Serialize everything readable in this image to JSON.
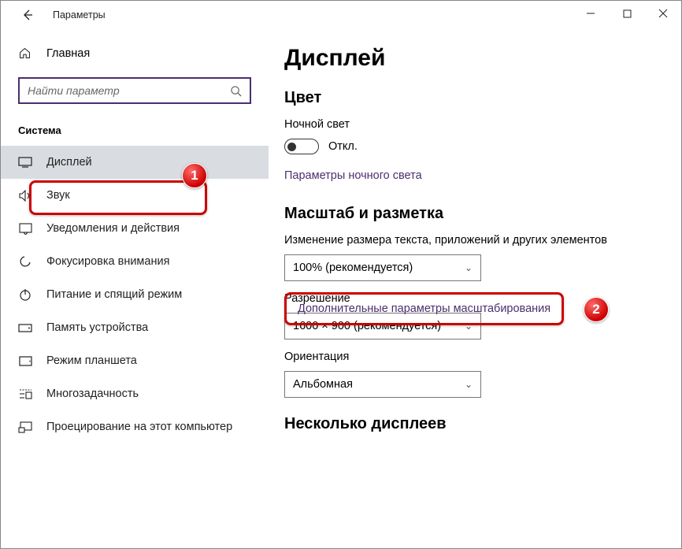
{
  "window": {
    "title": "Параметры"
  },
  "sidebar": {
    "home": "Главная",
    "search_placeholder": "Найти параметр",
    "group": "Система",
    "items": [
      {
        "label": "Дисплей"
      },
      {
        "label": "Звук"
      },
      {
        "label": "Уведомления и действия"
      },
      {
        "label": "Фокусировка внимания"
      },
      {
        "label": "Питание и спящий режим"
      },
      {
        "label": "Память устройства"
      },
      {
        "label": "Режим планшета"
      },
      {
        "label": "Многозадачность"
      },
      {
        "label": "Проецирование на этот компьютер"
      }
    ]
  },
  "main": {
    "title": "Дисплей",
    "color_section": "Цвет",
    "night_light_label": "Ночной свет",
    "toggle_off": "Откл.",
    "night_light_link": "Параметры ночного света",
    "scale_section": "Масштаб и разметка",
    "scale_label": "Изменение размера текста, приложений и других элементов",
    "scale_value": "100% (рекомендуется)",
    "adv_scale_link": "Дополнительные параметры масштабирования",
    "resolution_label": "Разрешение",
    "resolution_value": "1600 × 900 (рекомендуется)",
    "orientation_label": "Ориентация",
    "orientation_value": "Альбомная",
    "multi_section": "Несколько дисплеев"
  },
  "badges": {
    "one": "1",
    "two": "2"
  }
}
